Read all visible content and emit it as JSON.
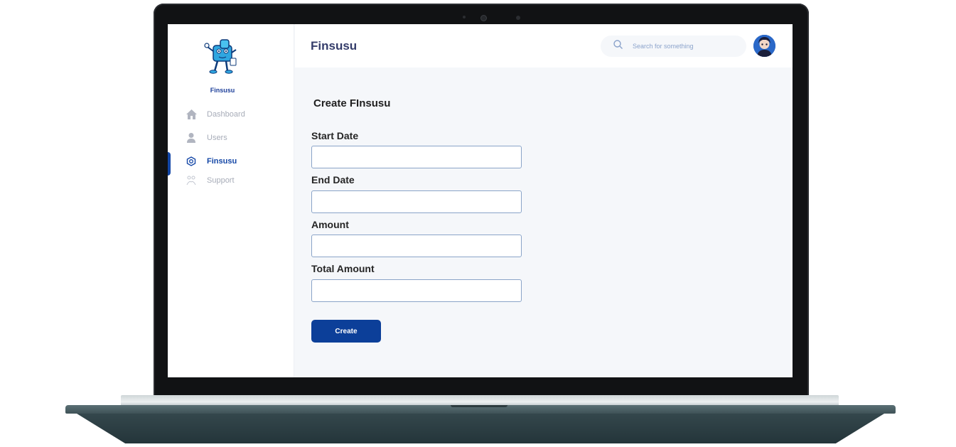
{
  "app": {
    "title": "Finsusu",
    "logo_text": "Finsusu"
  },
  "search": {
    "placeholder": "Search for something"
  },
  "sidebar": {
    "items": [
      {
        "label": "Dashboard",
        "icon": "home-icon",
        "active": false
      },
      {
        "label": "Users",
        "icon": "user-icon",
        "active": false
      },
      {
        "label": "Finsusu",
        "icon": "finsusu-icon",
        "active": true
      },
      {
        "label": "Support",
        "icon": "support-icon",
        "active": false
      }
    ]
  },
  "form": {
    "title": "Create FInsusu",
    "fields": [
      {
        "label": "Start Date",
        "value": ""
      },
      {
        "label": "End Date",
        "value": ""
      },
      {
        "label": "Amount",
        "value": ""
      },
      {
        "label": "Total Amount",
        "value": ""
      }
    ],
    "submit_label": "Create"
  },
  "colors": {
    "primary": "#0c3f99",
    "title": "#343c6a",
    "background": "#f5f7fa",
    "muted": "#a7acb8"
  }
}
